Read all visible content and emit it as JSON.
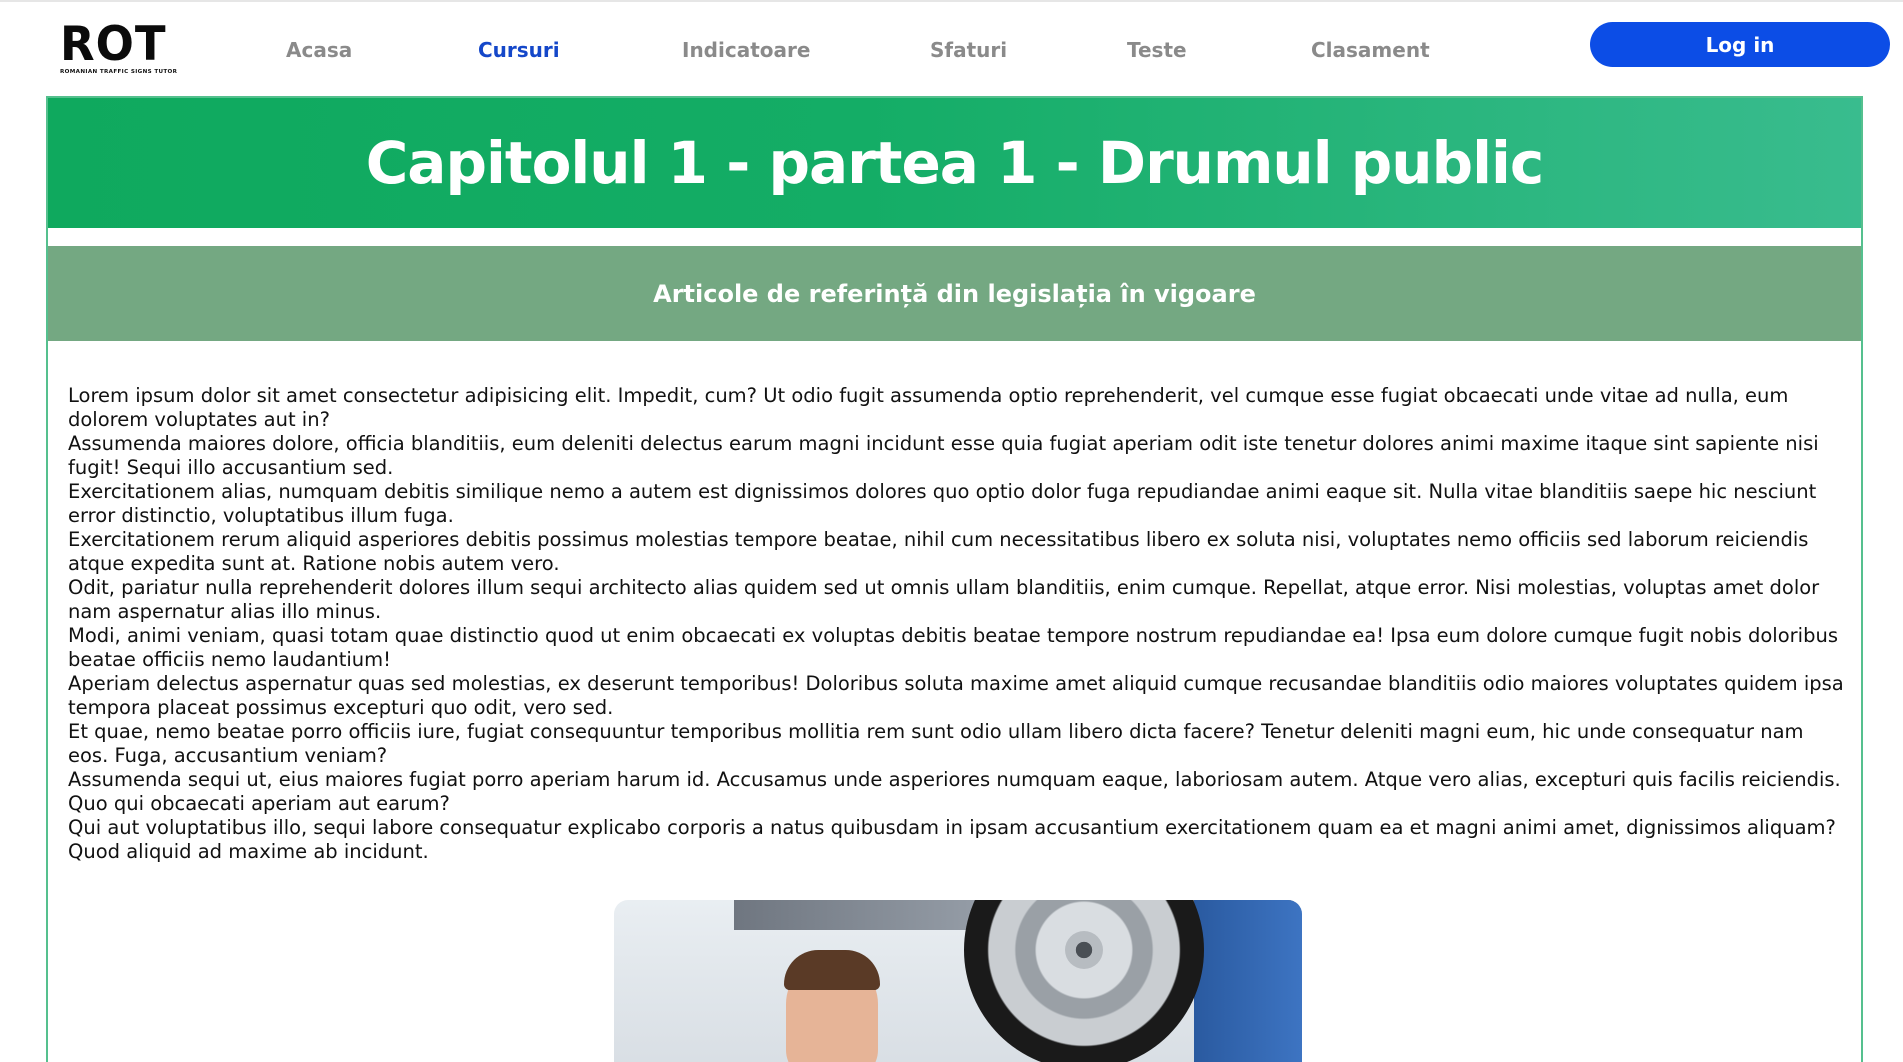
{
  "logo": {
    "text": "ROT",
    "tagline": "ROMANIAN TRAFFIC SIGNS TUTOR"
  },
  "nav": {
    "items": [
      {
        "label": "Acasa",
        "active": false
      },
      {
        "label": "Cursuri",
        "active": true
      },
      {
        "label": "Indicatoare",
        "active": false
      },
      {
        "label": "Sfaturi",
        "active": false
      },
      {
        "label": "Teste",
        "active": false
      },
      {
        "label": "Clasament",
        "active": false
      }
    ],
    "login_label": "Log in"
  },
  "page": {
    "title": "Capitolul 1 - partea 1 - Drumul public",
    "subtitle": "Articole de referință din legislația în vigoare",
    "paragraphs": [
      "Lorem ipsum dolor sit amet consectetur adipisicing elit. Impedit, cum? Ut odio fugit assumenda optio reprehenderit, vel cumque esse fugiat obcaecati unde vitae ad nulla, eum dolorem voluptates aut in?",
      "Assumenda maiores dolore, officia blanditiis, eum deleniti delectus earum magni incidunt esse quia fugiat aperiam odit iste tenetur dolores animi maxime itaque sint sapiente nisi fugit! Sequi illo accusantium sed.",
      "Exercitationem alias, numquam debitis similique nemo a autem est dignissimos dolores quo optio dolor fuga repudiandae animi eaque sit. Nulla vitae blanditiis saepe hic nesciunt error distinctio, voluptatibus illum fuga.",
      "Exercitationem rerum aliquid asperiores debitis possimus molestias tempore beatae, nihil cum necessitatibus libero ex soluta nisi, voluptates nemo officiis sed laborum reiciendis atque expedita sunt at. Ratione nobis autem vero.",
      "Odit, pariatur nulla reprehenderit dolores illum sequi architecto alias quidem sed ut omnis ullam blanditiis, enim cumque. Repellat, atque error. Nisi molestias, voluptas amet dolor nam aspernatur alias illo minus.",
      "Modi, animi veniam, quasi totam quae distinctio quod ut enim obcaecati ex voluptas debitis beatae tempore nostrum repudiandae ea! Ipsa eum dolore cumque fugit nobis doloribus beatae officiis nemo laudantium!",
      "Aperiam delectus aspernatur quas sed molestias, ex deserunt temporibus! Doloribus soluta maxime amet aliquid cumque recusandae blanditiis odio maiores voluptates quidem ipsa tempora placeat possimus excepturi quo odit, vero sed.",
      "Et quae, nemo beatae porro officiis iure, fugiat consequuntur temporibus mollitia rem sunt odio ullam libero dicta facere? Tenetur deleniti magni eum, hic unde consequatur nam eos. Fuga, accusantium veniam?",
      "Assumenda sequi ut, eius maiores fugiat porro aperiam harum id. Accusamus unde asperiores numquam eaque, laboriosam autem. Atque vero alias, excepturi quis facilis reiciendis. Quo qui obcaecati aperiam aut earum?",
      "Qui aut voluptatibus illo, sequi labore consequatur explicabo corporis a natus quibusdam in ipsam accusantium exercitationem quam ea et magni animi amet, dignissimos aliquam? Quod aliquid ad maxime ab incidunt."
    ]
  },
  "colors": {
    "title_band": "#14ad66",
    "subtitle_band": "#74a882",
    "nav_active": "#1447c9",
    "nav_inactive": "#8a8a8a",
    "login_button": "#0c4de6",
    "frame_border": "#55c08e"
  }
}
